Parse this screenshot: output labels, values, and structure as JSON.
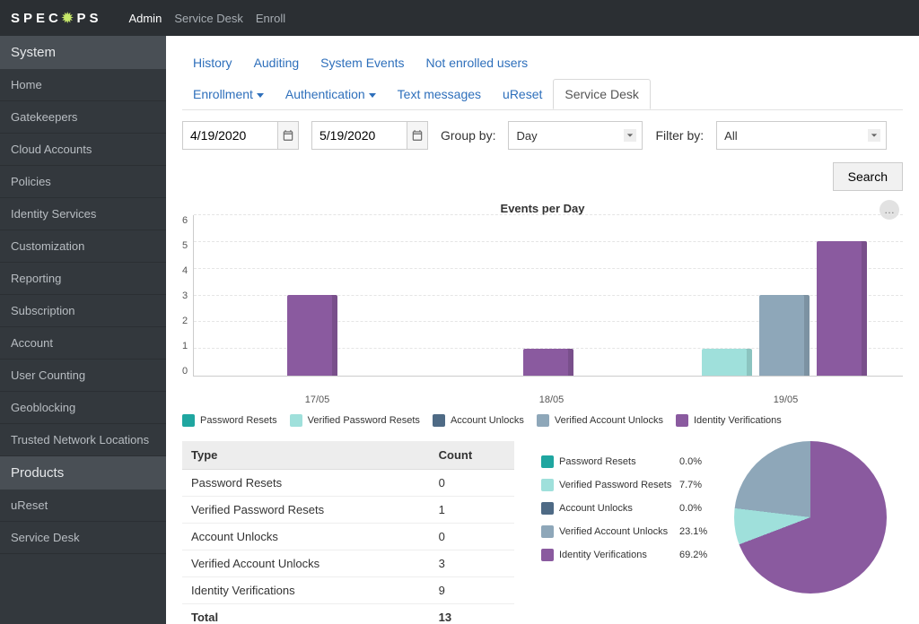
{
  "top": {
    "logo": "SPECOPS",
    "nav": [
      "Admin",
      "Service Desk",
      "Enroll"
    ],
    "active": 0
  },
  "sidebar": {
    "sections": [
      {
        "title": "System",
        "items": [
          "Home",
          "Gatekeepers",
          "Cloud Accounts",
          "Policies",
          "Identity Services",
          "Customization",
          "Reporting",
          "Subscription",
          "Account",
          "User Counting",
          "Geoblocking",
          "Trusted Network Locations"
        ]
      },
      {
        "title": "Products",
        "items": [
          "uReset",
          "Service Desk"
        ]
      }
    ]
  },
  "tabs_primary": [
    "History",
    "Auditing",
    "System Events",
    "Not enrolled users"
  ],
  "tabs_secondary": [
    "Enrollment",
    "Authentication",
    "Text messages",
    "uReset",
    "Service Desk"
  ],
  "tabs_secondary_caret": [
    true,
    true,
    false,
    false,
    false
  ],
  "tabs_secondary_active": 4,
  "controls": {
    "from": "4/19/2020",
    "to": "5/19/2020",
    "group_label": "Group by:",
    "group_value": "Day",
    "filter_label": "Filter by:",
    "filter_value": "All",
    "search": "Search"
  },
  "legend": [
    {
      "name": "Password Resets",
      "color": "#1fa6a0",
      "key": "pr"
    },
    {
      "name": "Verified Password Resets",
      "color": "#9fe0db",
      "key": "vpr"
    },
    {
      "name": "Account Unlocks",
      "color": "#4e6a85",
      "key": "au"
    },
    {
      "name": "Verified Account Unlocks",
      "color": "#8ea7b9",
      "key": "vau"
    },
    {
      "name": "Identity Verifications",
      "color": "#8a5a9f",
      "key": "iv"
    }
  ],
  "summary": {
    "headers": [
      "Type",
      "Count"
    ],
    "rows": [
      {
        "type": "Password Resets",
        "count": 0
      },
      {
        "type": "Verified Password Resets",
        "count": 1
      },
      {
        "type": "Account Unlocks",
        "count": 0
      },
      {
        "type": "Verified Account Unlocks",
        "count": 3
      },
      {
        "type": "Identity Verifications",
        "count": 9
      }
    ],
    "total_label": "Total",
    "total": 13
  },
  "percentages": [
    {
      "name": "Password Resets",
      "pct": "0.0%"
    },
    {
      "name": "Verified Password Resets",
      "pct": "7.7%"
    },
    {
      "name": "Account Unlocks",
      "pct": "0.0%"
    },
    {
      "name": "Verified Account Unlocks",
      "pct": "23.1%"
    },
    {
      "name": "Identity Verifications",
      "pct": "69.2%"
    }
  ],
  "chart_data": {
    "type": "bar",
    "title": "Events per Day",
    "ylabel": "",
    "xlabel": "",
    "ylim": [
      0,
      6
    ],
    "yticks": [
      0,
      1,
      2,
      3,
      4,
      5,
      6
    ],
    "categories": [
      "17/05",
      "18/05",
      "19/05"
    ],
    "series": [
      {
        "name": "Password Resets",
        "key": "pr",
        "values": [
          0,
          0,
          0
        ]
      },
      {
        "name": "Verified Password Resets",
        "key": "vpr",
        "values": [
          0,
          0,
          1
        ]
      },
      {
        "name": "Account Unlocks",
        "key": "au",
        "values": [
          0,
          0,
          0
        ]
      },
      {
        "name": "Verified Account Unlocks",
        "key": "vau",
        "values": [
          0,
          0,
          3
        ]
      },
      {
        "name": "Identity Verifications",
        "key": "iv",
        "values": [
          3,
          1,
          5
        ]
      }
    ],
    "pie": {
      "type": "pie",
      "slices": [
        {
          "name": "Password Resets",
          "value": 0,
          "pct": 0.0
        },
        {
          "name": "Verified Password Resets",
          "value": 1,
          "pct": 7.7
        },
        {
          "name": "Account Unlocks",
          "value": 0,
          "pct": 0.0
        },
        {
          "name": "Verified Account Unlocks",
          "value": 3,
          "pct": 23.1
        },
        {
          "name": "Identity Verifications",
          "value": 9,
          "pct": 69.2
        }
      ]
    }
  }
}
